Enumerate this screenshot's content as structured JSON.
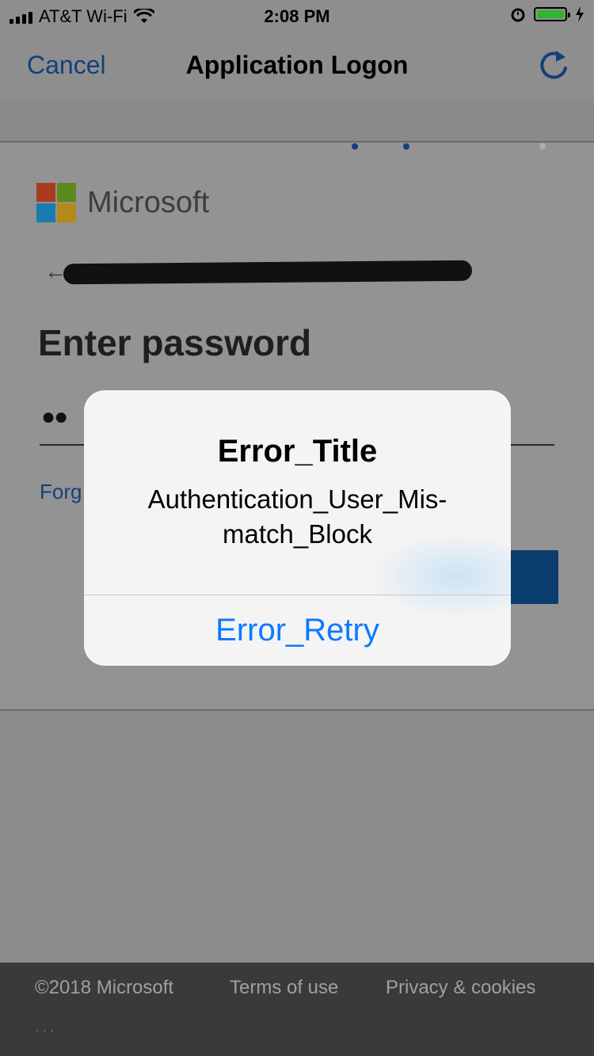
{
  "status_bar": {
    "carrier": "AT&T Wi-Fi",
    "time": "2:08 PM"
  },
  "nav": {
    "cancel_label": "Cancel",
    "title": "Application Logon",
    "refresh_icon": "refresh-icon"
  },
  "signin_page": {
    "brand": "Microsoft",
    "brand_colors": [
      "#f25022",
      "#7fba00",
      "#00a4ef",
      "#ffb900"
    ],
    "heading": "Enter password",
    "password_value": "●●",
    "forgot_label": "Forg",
    "accent_color": "#0b3e6f"
  },
  "alert": {
    "title": "Error_Title",
    "message": "Authentication_User_Mis-match_Block",
    "message_line1": "Authentication_User_Mis-",
    "message_line2": "match_Block",
    "button_label": "Error_Retry",
    "button_color": "#0a7aff"
  },
  "footer": {
    "copyright": "©2018 Microsoft",
    "terms_label": "Terms of use",
    "privacy_label": "Privacy & cookies",
    "more_label": "..."
  }
}
